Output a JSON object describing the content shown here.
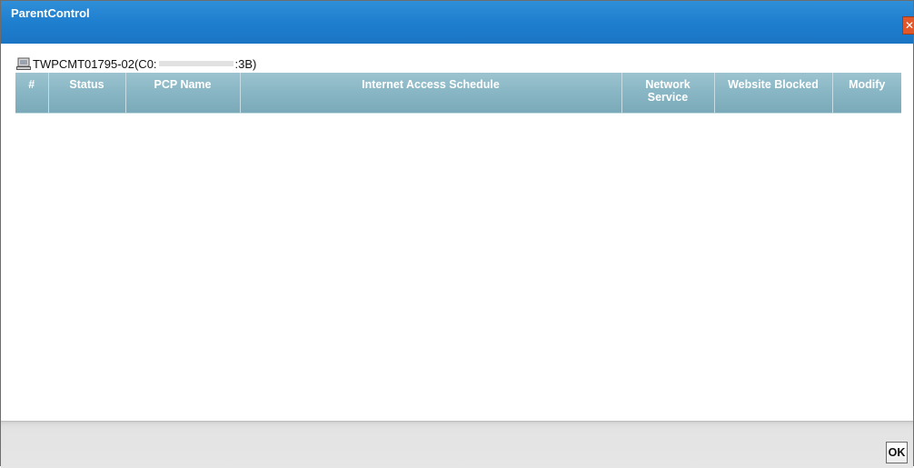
{
  "dialog": {
    "title": "ParentControl",
    "close_symbol": "✕"
  },
  "device": {
    "icon": "computer-icon",
    "name_prefix": "TWPCMT01795-02(C0:",
    "name_suffix": ":3B)"
  },
  "table": {
    "columns": [
      {
        "label": "#"
      },
      {
        "label": "Status"
      },
      {
        "label": "PCP Name"
      },
      {
        "label": "Internet Access Schedule"
      },
      {
        "label": "Network Service"
      },
      {
        "label": "Website Blocked"
      },
      {
        "label": "Modify"
      }
    ],
    "rows": []
  },
  "footer": {
    "ok_label": "OK"
  },
  "colors": {
    "titlebar": "#1f7fcf",
    "header": "#8ab7c5",
    "close": "#e2582a"
  }
}
